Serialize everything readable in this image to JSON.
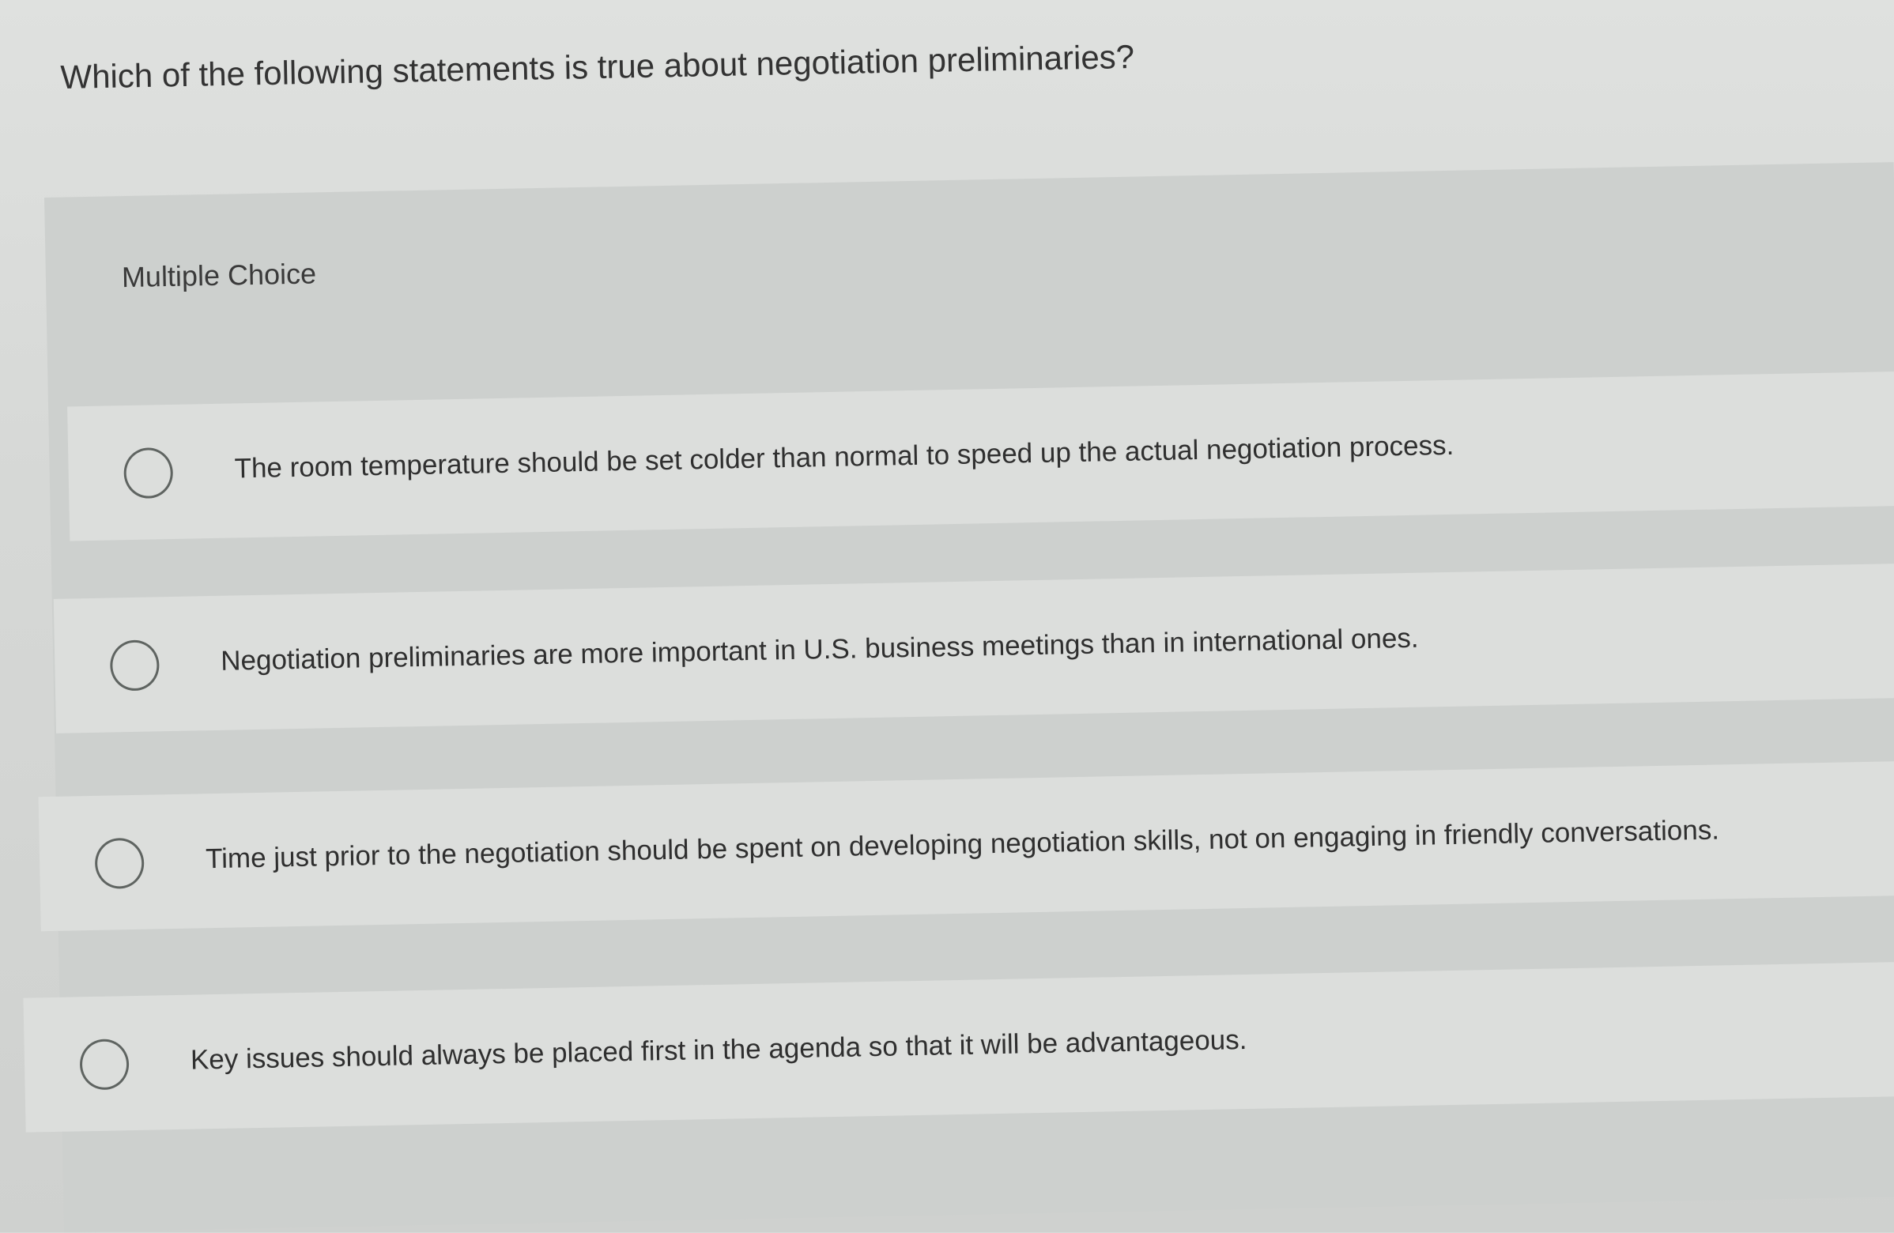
{
  "question": {
    "text": "Which of the following statements is true about negotiation preliminaries?"
  },
  "section": {
    "type_label": "Multiple Choice"
  },
  "options": [
    {
      "text": "The room temperature should be set colder than normal to speed up the actual negotiation process."
    },
    {
      "text": "Negotiation preliminaries are more important in U.S. business meetings than in international ones."
    },
    {
      "text": "Time just prior to the negotiation should be spent on developing negotiation skills, not on engaging in friendly conversations."
    },
    {
      "text": "Key issues should always be placed first in the agenda so that it will be advantageous."
    }
  ],
  "colors": {
    "background": "#d8dad8",
    "panel": "#cdd0ce",
    "option_background": "#dcdedc",
    "radio_border": "#5f6461",
    "text": "#2f2f2f"
  },
  "icons": {
    "radio": "empty-radio-circle"
  }
}
